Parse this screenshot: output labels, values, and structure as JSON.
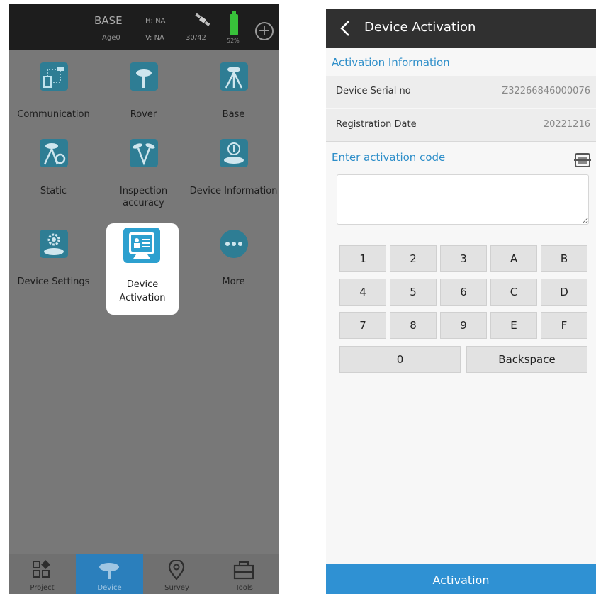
{
  "left_screen": {
    "status_bar": {
      "mode": "BASE",
      "age": "Age0",
      "h_accuracy": "H: NA",
      "v_accuracy": "V: NA",
      "satellites": "30/42",
      "battery": "52%",
      "battery_color": "#38c13a"
    },
    "grid": [
      {
        "label": "Communication",
        "icon": "communication-icon"
      },
      {
        "label": "Rover",
        "icon": "rover-icon"
      },
      {
        "label": "Base",
        "icon": "base-tripod-icon"
      },
      {
        "label": "Static",
        "icon": "static-icon"
      },
      {
        "label": "Inspection accuracy",
        "icon": "inspection-icon"
      },
      {
        "label": "Device Information",
        "icon": "device-info-icon"
      },
      {
        "label": "Device Settings",
        "icon": "device-settings-icon"
      },
      {
        "label": "Device Activation",
        "icon": "device-activation-icon",
        "highlighted": true
      },
      {
        "label": "More",
        "icon": "more-icon"
      }
    ],
    "bottom_nav": [
      {
        "label": "Project",
        "icon": "project-icon"
      },
      {
        "label": "Device",
        "icon": "device-icon",
        "active": true
      },
      {
        "label": "Survey",
        "icon": "survey-icon"
      },
      {
        "label": "Tools",
        "icon": "tools-icon"
      }
    ]
  },
  "right_screen": {
    "title": "Device Activation",
    "activation_info_title": "Activation Information",
    "rows": [
      {
        "key": "Device Serial no",
        "value": "Z32266846000076"
      },
      {
        "key": "Registration Date",
        "value": "20221216"
      }
    ],
    "enter_code_label": "Enter activation code",
    "code_value": "",
    "keypad": [
      [
        "1",
        "2",
        "3",
        "A",
        "B"
      ],
      [
        "4",
        "5",
        "6",
        "C",
        "D"
      ],
      [
        "7",
        "8",
        "9",
        "E",
        "F"
      ],
      [
        "0",
        "Backspace"
      ]
    ],
    "activate_label": "Activation",
    "accent_color": "#2d8ec9"
  }
}
